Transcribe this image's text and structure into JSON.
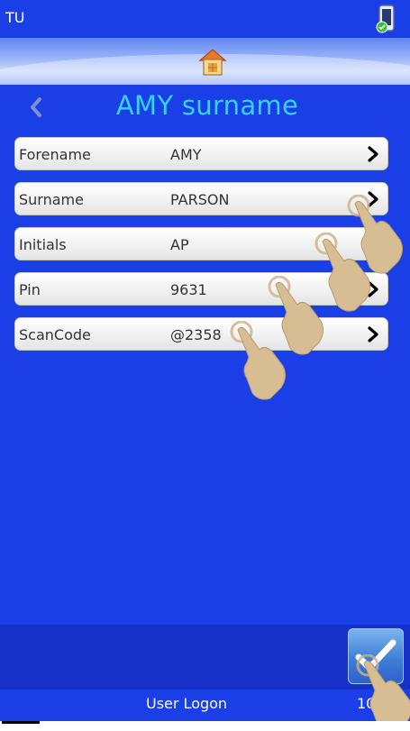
{
  "status_bar": {
    "title": "TU",
    "icon": "phone-sync-icon"
  },
  "ribbon": {
    "icon": "home-icon"
  },
  "header": {
    "back_icon": "chevron-left-icon",
    "title": "AMY surname"
  },
  "fields": [
    {
      "label": "Forename",
      "value": "AMY"
    },
    {
      "label": "Surname",
      "value": "PARSON"
    },
    {
      "label": "Initials",
      "value": "AP"
    },
    {
      "label": "Pin",
      "value": "9631"
    },
    {
      "label": "ScanCode",
      "value": "@2358"
    }
  ],
  "footer": {
    "confirm_icon": "checkmark-icon",
    "label": "User Logon",
    "clock": "10:"
  },
  "overlay": {
    "gesture_icon": "tap-hand-icon"
  },
  "colors": {
    "background": "#1a3fe6",
    "title": "#34d2ff",
    "row": "#f0f0f0",
    "footer_band": "#1631c8"
  }
}
